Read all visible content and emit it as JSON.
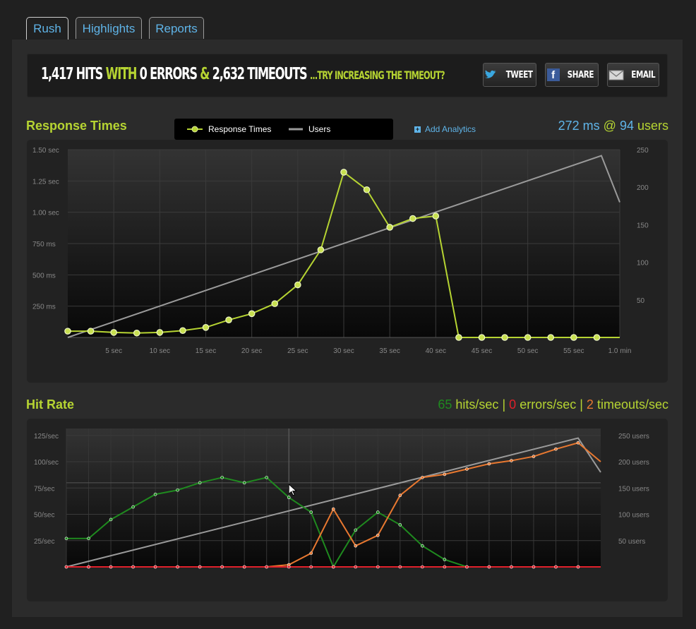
{
  "tabs": [
    {
      "label": "Rush",
      "active": true
    },
    {
      "label": "Highlights",
      "active": false
    },
    {
      "label": "Reports",
      "active": false
    }
  ],
  "banner": {
    "hits": "1,417 HITS",
    "with": "WITH",
    "errors": "0 ERRORS",
    "amp": "&",
    "timeouts": "2,632 TIMEOUTS",
    "hint": "...TRY INCREASING THE TIMEOUT?"
  },
  "share_buttons": [
    {
      "label": "TWEET",
      "icon": "twitter-bird-icon"
    },
    {
      "label": "SHARE",
      "icon": "facebook-icon"
    },
    {
      "label": "EMAIL",
      "icon": "envelope-icon"
    }
  ],
  "response_section": {
    "title": "Response Times",
    "legend": [
      "Response Times",
      "Users"
    ],
    "add_analytics": "Add Analytics",
    "stat": {
      "ms": "272 ms",
      "at": "@",
      "users": "94",
      "users_label": "users"
    }
  },
  "hit_section": {
    "title": "Hit Rate",
    "stat": {
      "hits": "65",
      "hits_label": "hits/sec",
      "sep": "|",
      "errors": "0",
      "errors_label": "errors/sec",
      "timeouts": "2",
      "timeouts_label": "timeouts/sec"
    }
  },
  "colors": {
    "accent_green": "#b6d432",
    "link_blue": "#5fb4e8",
    "hits_green": "#1f8a1f",
    "errors_red": "#e0202a",
    "timeouts_orange": "#e87830",
    "users_gray": "#9a9a9a"
  },
  "chart_data": [
    {
      "type": "line",
      "name": "response-times",
      "x": [
        0,
        2.5,
        5,
        7.5,
        10,
        12.5,
        15,
        17.5,
        20,
        22.5,
        25,
        27.5,
        30,
        32.5,
        35,
        37.5,
        40,
        42.5,
        45,
        47.5,
        50,
        52.5,
        55,
        57.5
      ],
      "x_unit": "sec",
      "x_ticks": [
        "5 sec",
        "10 sec",
        "15 sec",
        "20 sec",
        "25 sec",
        "30 sec",
        "35 sec",
        "40 sec",
        "45 sec",
        "50 sec",
        "55 sec",
        "1.0 min"
      ],
      "xlim": [
        0,
        60
      ],
      "y_left_ticks": [
        "250 ms",
        "500 ms",
        "750 ms",
        "1.00 sec",
        "1.25 sec",
        "1.50 sec"
      ],
      "y_left_range_ms": [
        0,
        1500
      ],
      "y_right_ticks": [
        "50",
        "100",
        "150",
        "200",
        "250"
      ],
      "y_right_range": [
        0,
        250
      ],
      "series": [
        {
          "name": "Response Times",
          "axis": "left",
          "values_ms": [
            50,
            50,
            40,
            35,
            40,
            55,
            80,
            140,
            190,
            270,
            420,
            700,
            1320,
            1180,
            880,
            950,
            970,
            0,
            0,
            0,
            0,
            0,
            0,
            0
          ]
        },
        {
          "name": "Users",
          "axis": "right",
          "x": [
            0,
            60
          ],
          "values": [
            0,
            245
          ],
          "end_drop": [
            [
              58,
              242
            ],
            [
              60,
              180
            ]
          ]
        }
      ]
    },
    {
      "type": "line",
      "name": "hit-rate",
      "x_count": 24,
      "y_left_ticks": [
        "25/sec",
        "50/sec",
        "75/sec",
        "100/sec",
        "125/sec"
      ],
      "y_left_range": [
        0,
        125
      ],
      "y_right_ticks": [
        "50 users",
        "100 users",
        "150 users",
        "200 users",
        "250 users"
      ],
      "y_right_range": [
        0,
        250
      ],
      "series": [
        {
          "name": "hits/sec",
          "values": [
            27,
            27,
            45,
            57,
            69,
            73,
            80,
            85,
            80,
            85,
            66,
            52,
            0,
            35,
            52,
            40,
            20,
            7,
            0,
            0,
            0,
            0,
            0,
            0
          ]
        },
        {
          "name": "errors/sec",
          "values": [
            0,
            0,
            0,
            0,
            0,
            0,
            0,
            0,
            0,
            0,
            0,
            0,
            0,
            0,
            0,
            0,
            0,
            0,
            0,
            0,
            0,
            0,
            0,
            0
          ]
        },
        {
          "name": "timeouts/sec",
          "values": [
            0,
            0,
            0,
            0,
            0,
            0,
            0,
            0,
            0,
            0,
            2,
            13,
            55,
            20,
            30,
            68,
            85,
            88,
            93,
            98,
            101,
            105,
            112,
            118
          ]
        },
        {
          "name": "Users",
          "values": [
            0,
            245
          ]
        }
      ]
    }
  ]
}
